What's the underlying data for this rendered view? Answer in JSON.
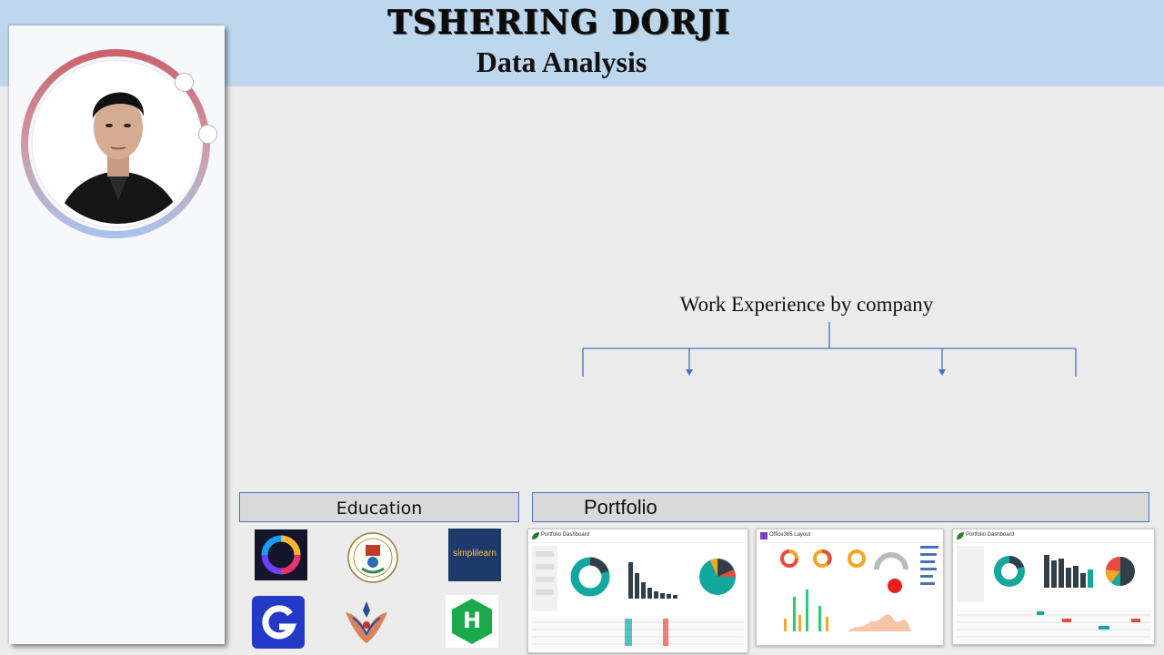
{
  "header": {
    "name": "TSHERING DORJI",
    "subtitle": "Data Analysis",
    "band_color": "#bdd7ee"
  },
  "sidebar": {
    "profile_photo": "profile-photo",
    "ring_colors": [
      "#c9626d",
      "#a9c3ea"
    ]
  },
  "work_experience": {
    "title": "Work Experience by company"
  },
  "education": {
    "label": "Education",
    "logos": [
      "sololearn-logo",
      "university-seal-logo",
      "simplilearn-logo",
      "g-logo",
      "institution-emblem-logo",
      "hackerrank-logo"
    ],
    "simplilearn_text": "simplilearn",
    "hackerrank_text": "H"
  },
  "portfolio": {
    "label": "Portfolio",
    "thumbnails": [
      {
        "title": "Portfolio Dashboard"
      },
      {
        "title": "Office365 Layout"
      },
      {
        "title": "Portfolio Dashboard"
      }
    ]
  },
  "colors": {
    "accent": "#4472c4",
    "teal": "#12a89d",
    "dark": "#333f48",
    "orange": "#f5a623",
    "red": "#e84c3d"
  }
}
